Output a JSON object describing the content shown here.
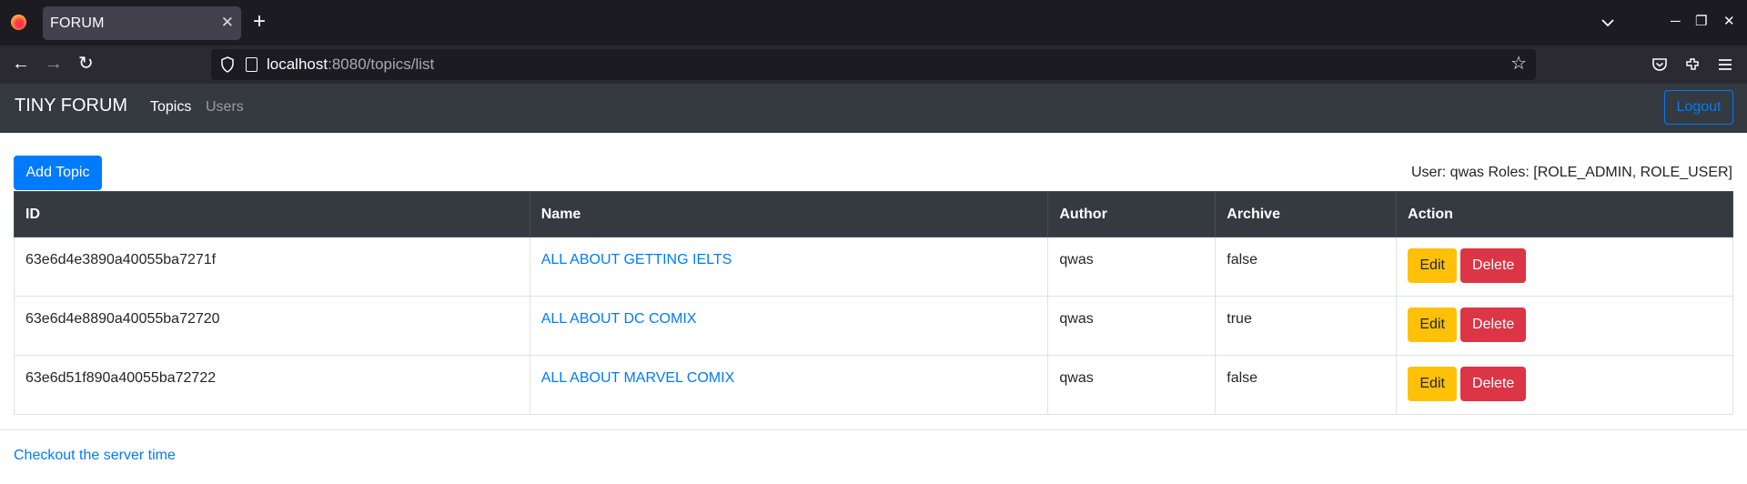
{
  "browser": {
    "tab_title": "FORUM",
    "tab_close": "✕",
    "new_tab": "+",
    "url_host": "localhost",
    "url_rest": ":8080/topics/list",
    "back": "←",
    "forward": "→",
    "reload": "↻",
    "bookmark": "☆",
    "minimize": "─",
    "restore": "❐",
    "close": "✕"
  },
  "nav": {
    "brand": "TINY FORUM",
    "links": [
      "Topics",
      "Users"
    ],
    "logout": "Logout"
  },
  "toolbar": {
    "add_topic": "Add Topic",
    "user_info": "User: qwas Roles: [ROLE_ADMIN, ROLE_USER]"
  },
  "table": {
    "headers": [
      "ID",
      "Name",
      "Author",
      "Archive",
      "Action"
    ],
    "rows": [
      {
        "id": "63e6d4e3890a40055ba7271f",
        "name": "ALL ABOUT GETTING IELTS",
        "author": "qwas",
        "archive": "false"
      },
      {
        "id": "63e6d4e8890a40055ba72720",
        "name": "ALL ABOUT DC COMIX",
        "author": "qwas",
        "archive": "true"
      },
      {
        "id": "63e6d51f890a40055ba72722",
        "name": "ALL ABOUT MARVEL COMIX",
        "author": "qwas",
        "archive": "false"
      }
    ],
    "edit_label": "Edit",
    "delete_label": "Delete"
  },
  "footer": {
    "link": "Checkout the server time"
  },
  "colors": {
    "primary": "#007bff",
    "warning": "#ffc107",
    "danger": "#dc3545",
    "dark": "#343a40"
  }
}
